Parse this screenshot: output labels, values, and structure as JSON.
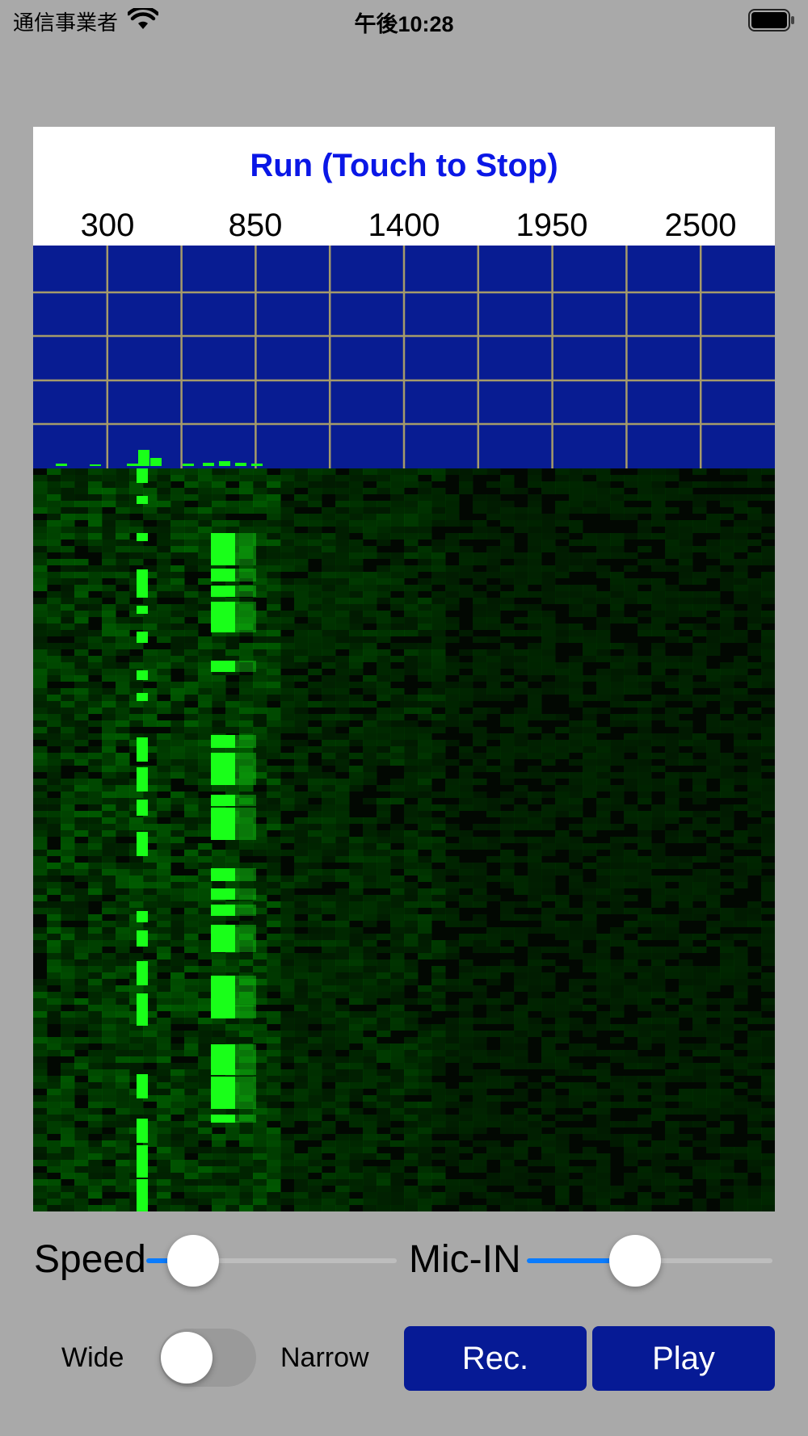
{
  "status_bar": {
    "carrier": "通信事業者",
    "time": "午後10:28",
    "wifi_icon": "wifi-icon",
    "battery_icon": "battery-full-icon"
  },
  "display": {
    "title": "Run (Touch to Stop)",
    "freq_labels": [
      "300",
      "850",
      "1400",
      "1950",
      "2500"
    ],
    "colors": {
      "title": "#0a17e6",
      "spectrum_bg": "#081c92",
      "grid": "#a59a6a",
      "signal": "#19ff19",
      "waterfall_bg": "#020802"
    }
  },
  "controls": {
    "speed_label": "Speed",
    "speed_value": 0.2,
    "mic_label": "Mic-IN",
    "mic_value": 0.44,
    "wide_label": "Wide",
    "narrow_label": "Narrow",
    "bandwidth_toggle_on": false,
    "rec_label": "Rec.",
    "play_label": "Play",
    "button_color": "#061a95",
    "accent": "#0a7cff"
  }
}
